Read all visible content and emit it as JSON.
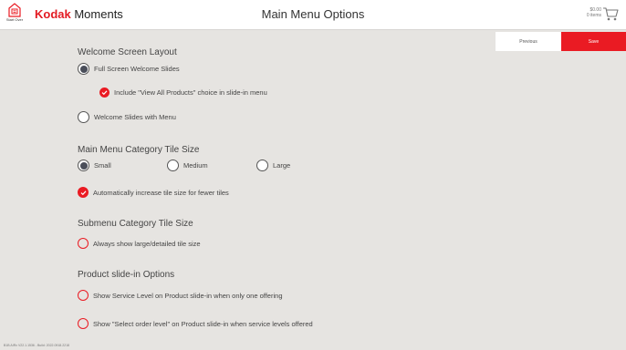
{
  "header": {
    "start_over_label": "Start Over",
    "brand_kodak": "Kodak",
    "brand_moments": " Moments",
    "title": "Main Menu Options",
    "cart_amount": "$0.00",
    "cart_items": "0 items"
  },
  "buttons": {
    "previous": "Previous",
    "save": "Save"
  },
  "sections": {
    "welcome": {
      "title": "Welcome Screen Layout",
      "full_screen": "Full Screen Welcome Slides",
      "include_view_all": "Include \"View All Products\" choice in slide-in menu",
      "slides_with_menu": "Welcome Slides with Menu"
    },
    "tile_size": {
      "title": "Main Menu Category Tile Size",
      "small": "Small",
      "medium": "Medium",
      "large": "Large",
      "auto_increase": "Automatically increase tile size for fewer tiles"
    },
    "submenu": {
      "title": "Submenu Category Tile Size",
      "always_large": "Always show large/detailed tile size"
    },
    "product": {
      "title": "Product slide-in Options",
      "service_level": "Show Service Level on Product slide-in when only one offering",
      "select_order": "Show \"Select order level\" on Product slide-in when service levels offered"
    }
  },
  "footer": {
    "version": "B1B AIRx V22.1.1536 - Build: 2022.0918.2218"
  },
  "colors": {
    "accent": "#ea1b23",
    "selected_radio": "#4a4e5a",
    "background": "#e6e4e1"
  },
  "state": {
    "full_screen_selected": true,
    "include_view_all_checked": true,
    "tile_size_selected": "Small",
    "auto_increase_checked": true,
    "always_large_checked": false,
    "service_level_checked": false,
    "select_order_checked": false
  }
}
